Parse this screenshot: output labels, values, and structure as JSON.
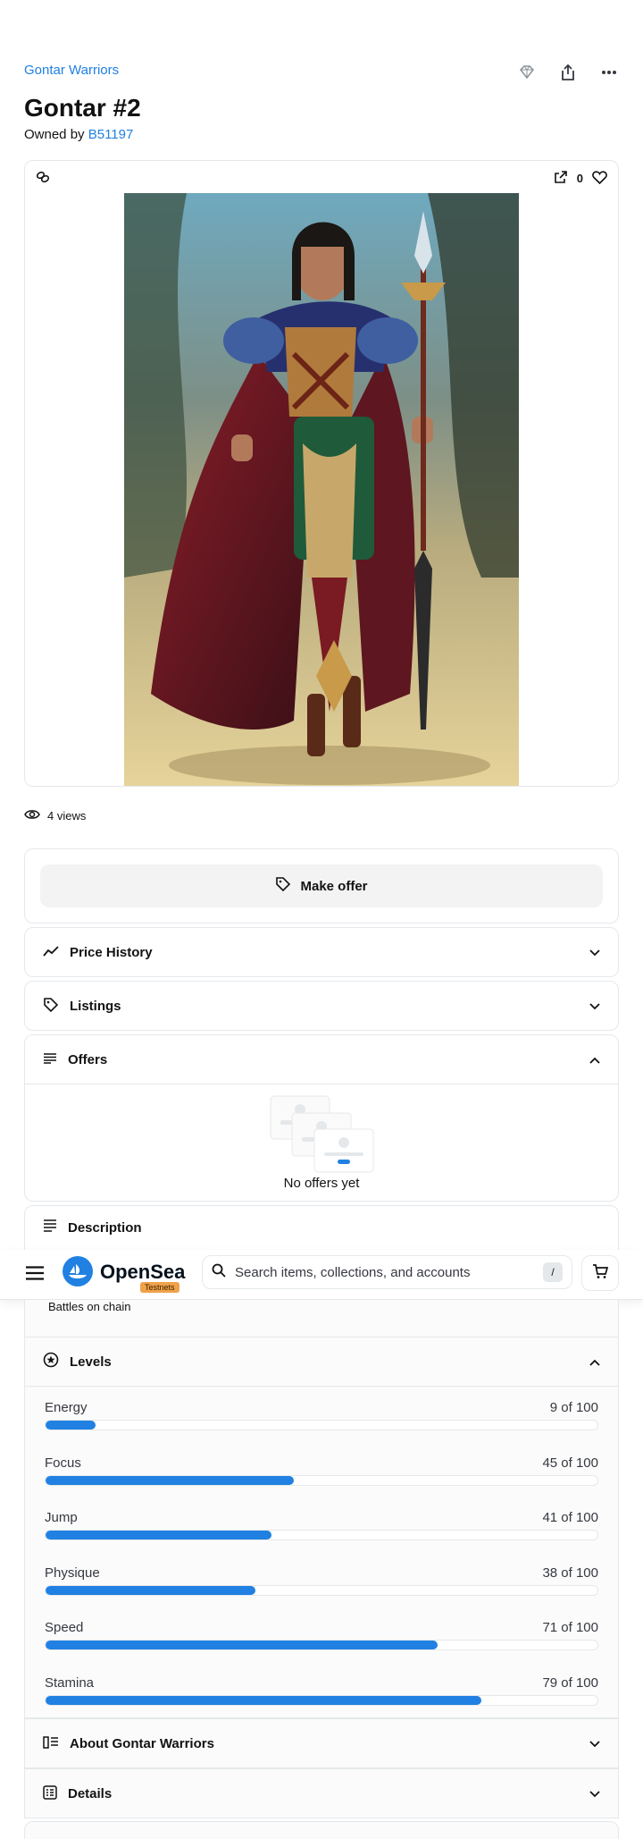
{
  "header": {
    "collection": "Gontar Warriors",
    "title": "Gontar #2",
    "owned_prefix": "Owned by",
    "owner": "B51197"
  },
  "media": {
    "like_count": "0"
  },
  "stats": {
    "views": "4 views"
  },
  "offer": {
    "button_label": "Make offer"
  },
  "sections": {
    "price_history": "Price History",
    "listings": "Listings",
    "offers": "Offers",
    "offers_empty": "No offers yet",
    "description": "Description",
    "description_text": "Battles on chain",
    "levels": "Levels",
    "about": "About Gontar Warriors",
    "details": "Details"
  },
  "navbar": {
    "brand": "OpenSea",
    "badge": "Testnets",
    "search_placeholder": "Search items, collections, and accounts",
    "shortcut": "/"
  },
  "levels": [
    {
      "name": "Energy",
      "value": 9,
      "max": 100,
      "label": "9 of 100"
    },
    {
      "name": "Focus",
      "value": 45,
      "max": 100,
      "label": "45 of 100"
    },
    {
      "name": "Jump",
      "value": 41,
      "max": 100,
      "label": "41 of 100"
    },
    {
      "name": "Physique",
      "value": 38,
      "max": 100,
      "label": "38 of 100"
    },
    {
      "name": "Speed",
      "value": 71,
      "max": 100,
      "label": "71 of 100"
    },
    {
      "name": "Stamina",
      "value": 79,
      "max": 100,
      "label": "79 of 100"
    }
  ],
  "colors": {
    "accent": "#2081e2",
    "badge": "#f0a24a"
  },
  "icons": [
    "chain-icon",
    "external-link-icon",
    "heart-icon",
    "eye-icon",
    "tag-icon",
    "trend-icon",
    "list-icon",
    "star-icon",
    "book-icon",
    "grid-icon",
    "chevron-down-icon",
    "chevron-up-icon",
    "search-icon",
    "cart-icon",
    "menu-icon",
    "share-icon",
    "more-icon",
    "diamond-icon"
  ]
}
